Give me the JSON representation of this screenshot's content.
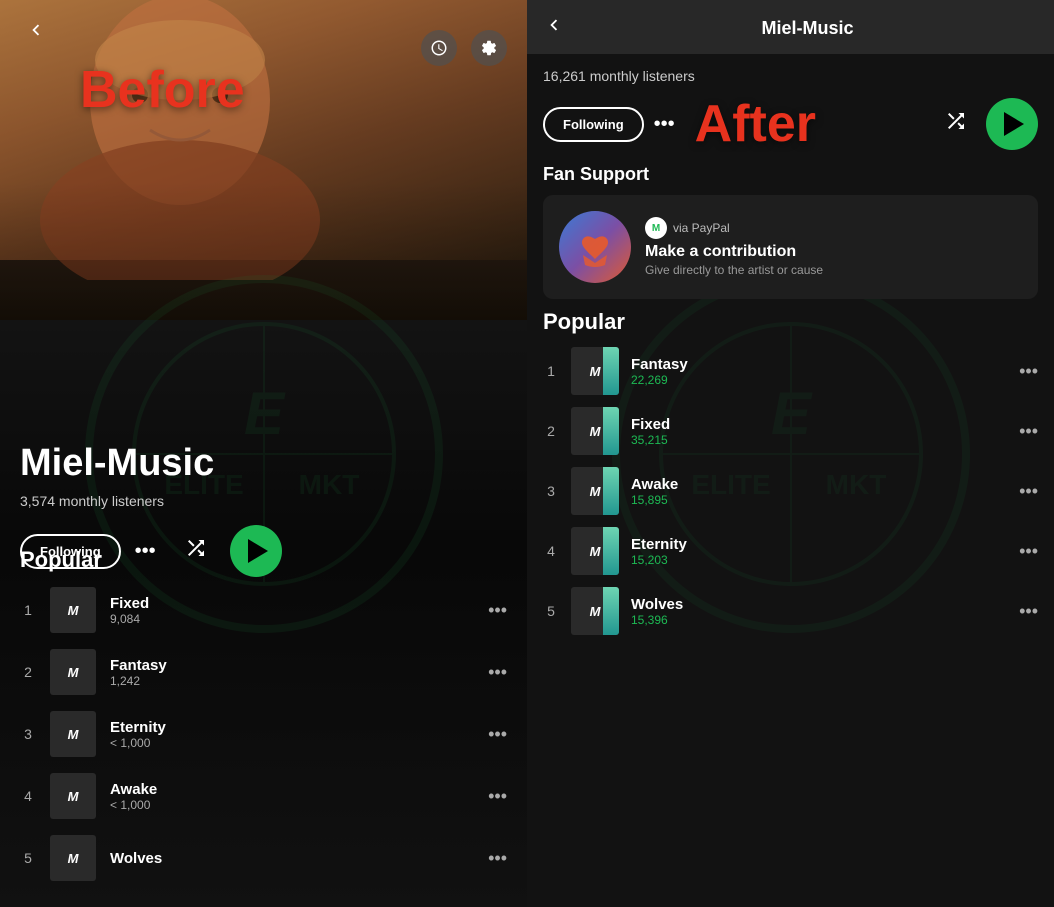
{
  "left": {
    "artist_name": "Miel-Music",
    "monthly_listeners": "3,574 monthly listeners",
    "following_label": "Following",
    "before_label": "Before",
    "popular_heading": "Popular",
    "tracks": [
      {
        "num": "1",
        "title": "Fixed",
        "plays": "9,084"
      },
      {
        "num": "2",
        "title": "Fantasy",
        "plays": "1,242"
      },
      {
        "num": "3",
        "title": "Eternity",
        "plays": "< 1,000"
      },
      {
        "num": "4",
        "title": "Awake",
        "plays": "< 1,000"
      },
      {
        "num": "5",
        "title": "Wolves",
        "plays": ""
      }
    ]
  },
  "right": {
    "header_title": "Miel-Music",
    "monthly_listeners": "16,261 monthly listeners",
    "following_label": "Following",
    "after_label": "After",
    "fan_support": {
      "section_title": "Fan Support",
      "via_label": "via PayPal",
      "m_initial": "M",
      "title": "Make a contribution",
      "subtitle": "Give directly to the artist or cause"
    },
    "popular_heading": "Popular",
    "tracks": [
      {
        "num": "1",
        "title": "Fantasy",
        "plays": "22,269"
      },
      {
        "num": "2",
        "title": "Fixed",
        "plays": "35,215"
      },
      {
        "num": "3",
        "title": "Awake",
        "plays": "15,895"
      },
      {
        "num": "4",
        "title": "Eternity",
        "plays": "15,203"
      },
      {
        "num": "5",
        "title": "Wolves",
        "plays": "15,396"
      }
    ]
  }
}
